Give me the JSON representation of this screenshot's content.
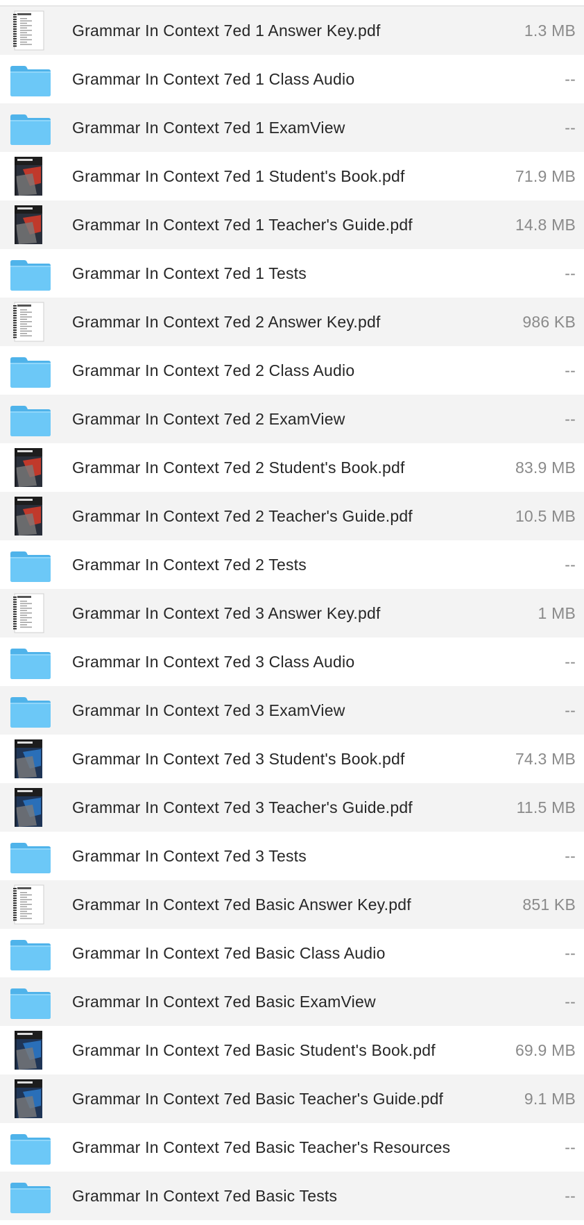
{
  "files": [
    {
      "name": "Grammar In Context 7ed 1 Answer Key.pdf",
      "size": "1.3 MB",
      "icon": "answer-key-pdf-icon"
    },
    {
      "name": "Grammar In Context 7ed 1 Class Audio",
      "size": "--",
      "icon": "folder-icon"
    },
    {
      "name": "Grammar In Context 7ed 1 ExamView",
      "size": "--",
      "icon": "folder-icon"
    },
    {
      "name": "Grammar In Context 7ed 1 Student's Book.pdf",
      "size": "71.9 MB",
      "icon": "book-cover-red-pdf-icon"
    },
    {
      "name": "Grammar In Context 7ed 1 Teacher's Guide.pdf",
      "size": "14.8 MB",
      "icon": "book-cover-red-pdf-icon"
    },
    {
      "name": "Grammar In Context 7ed 1 Tests",
      "size": "--",
      "icon": "folder-icon"
    },
    {
      "name": "Grammar In Context 7ed 2 Answer Key.pdf",
      "size": "986 KB",
      "icon": "answer-key-pdf-icon"
    },
    {
      "name": "Grammar In Context 7ed 2 Class Audio",
      "size": "--",
      "icon": "folder-icon"
    },
    {
      "name": "Grammar In Context 7ed 2 ExamView",
      "size": "--",
      "icon": "folder-icon"
    },
    {
      "name": "Grammar In Context 7ed 2 Student's Book.pdf",
      "size": "83.9 MB",
      "icon": "book-cover-red-pdf-icon"
    },
    {
      "name": "Grammar In Context 7ed 2 Teacher's Guide.pdf",
      "size": "10.5 MB",
      "icon": "book-cover-red-pdf-icon"
    },
    {
      "name": "Grammar In Context 7ed 2 Tests",
      "size": "--",
      "icon": "folder-icon"
    },
    {
      "name": "Grammar In Context 7ed 3 Answer Key.pdf",
      "size": "1 MB",
      "icon": "answer-key-pdf-icon"
    },
    {
      "name": "Grammar In Context 7ed 3 Class Audio",
      "size": "--",
      "icon": "folder-icon"
    },
    {
      "name": "Grammar In Context 7ed 3 ExamView",
      "size": "--",
      "icon": "folder-icon"
    },
    {
      "name": "Grammar In Context 7ed 3 Student's Book.pdf",
      "size": "74.3 MB",
      "icon": "book-cover-blue-pdf-icon"
    },
    {
      "name": "Grammar In Context 7ed 3 Teacher's Guide.pdf",
      "size": "11.5 MB",
      "icon": "book-cover-blue-pdf-icon"
    },
    {
      "name": "Grammar In Context 7ed 3 Tests",
      "size": "--",
      "icon": "folder-icon"
    },
    {
      "name": "Grammar In Context 7ed Basic Answer Key.pdf",
      "size": "851 KB",
      "icon": "answer-key-pdf-icon"
    },
    {
      "name": "Grammar In Context 7ed Basic Class Audio",
      "size": "--",
      "icon": "folder-icon"
    },
    {
      "name": "Grammar In Context 7ed Basic ExamView",
      "size": "--",
      "icon": "folder-icon"
    },
    {
      "name": "Grammar In Context 7ed Basic Student's Book.pdf",
      "size": "69.9 MB",
      "icon": "book-cover-blue-pdf-icon"
    },
    {
      "name": "Grammar In Context 7ed Basic Teacher's Guide.pdf",
      "size": "9.1 MB",
      "icon": "book-cover-blue-pdf-icon"
    },
    {
      "name": "Grammar In Context 7ed Basic Teacher's Resources",
      "size": "--",
      "icon": "folder-icon"
    },
    {
      "name": "Grammar In Context 7ed Basic Tests",
      "size": "--",
      "icon": "folder-icon"
    }
  ],
  "colors": {
    "stripe": "#f3f3f3",
    "folder_front": "#6cc8f7",
    "folder_back": "#4fb3ea",
    "name_text": "#262626",
    "size_text": "#8a8a8a"
  }
}
